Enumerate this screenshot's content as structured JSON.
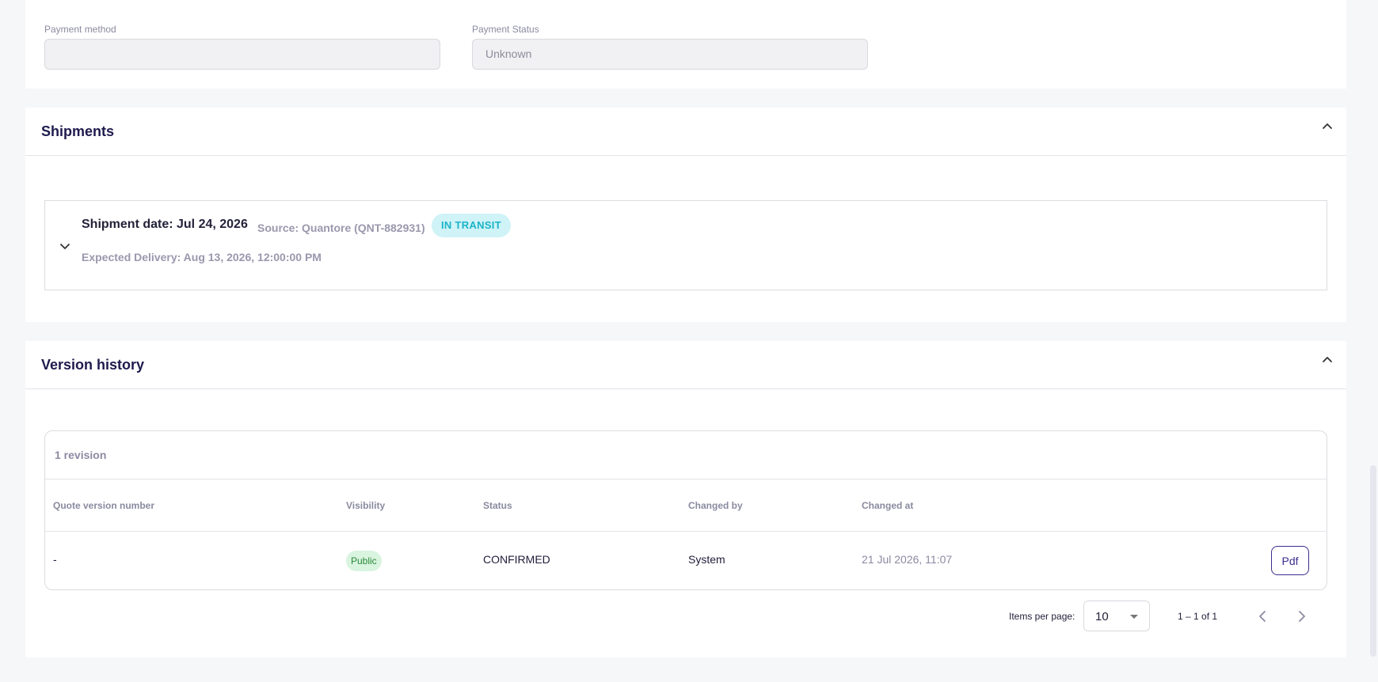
{
  "payment": {
    "method_label": "Payment method",
    "method_value": "",
    "status_label": "Payment Status",
    "status_value": "Unknown"
  },
  "shipments": {
    "title": "Shipments",
    "items": [
      {
        "date": "Shipment date: Jul 24, 2026",
        "source": "Source: Quantore (QNT-882931)",
        "status": "IN TRANSIT",
        "expected": "Expected Delivery: Aug 13, 2026, 12:00:00 PM"
      }
    ]
  },
  "version_history": {
    "title": "Version history",
    "revision_count": "1 revision",
    "columns": [
      "Quote version number",
      "Visibility",
      "Status",
      "Changed by",
      "Changed at"
    ],
    "rows": [
      {
        "version": "-",
        "visibility": "Public",
        "status": "CONFIRMED",
        "changed_by": "System",
        "changed_at": "21 Jul 2026, 11:07",
        "action": "Pdf"
      }
    ],
    "pagination": {
      "items_per_page_label": "Items per page:",
      "items_per_page": "10",
      "range": "1 – 1 of 1"
    }
  },
  "colors": {
    "accent": "#3b2d8c",
    "transit_bg": "#cff3f7",
    "transit_text": "#1cb4c8",
    "public_bg": "#d9f4df",
    "public_text": "#2a8a3a"
  },
  "icons": {
    "collapse": "chevron-up-icon",
    "expand": "chevron-down-icon",
    "prev": "chevron-left-icon",
    "next": "chevron-right-icon"
  }
}
